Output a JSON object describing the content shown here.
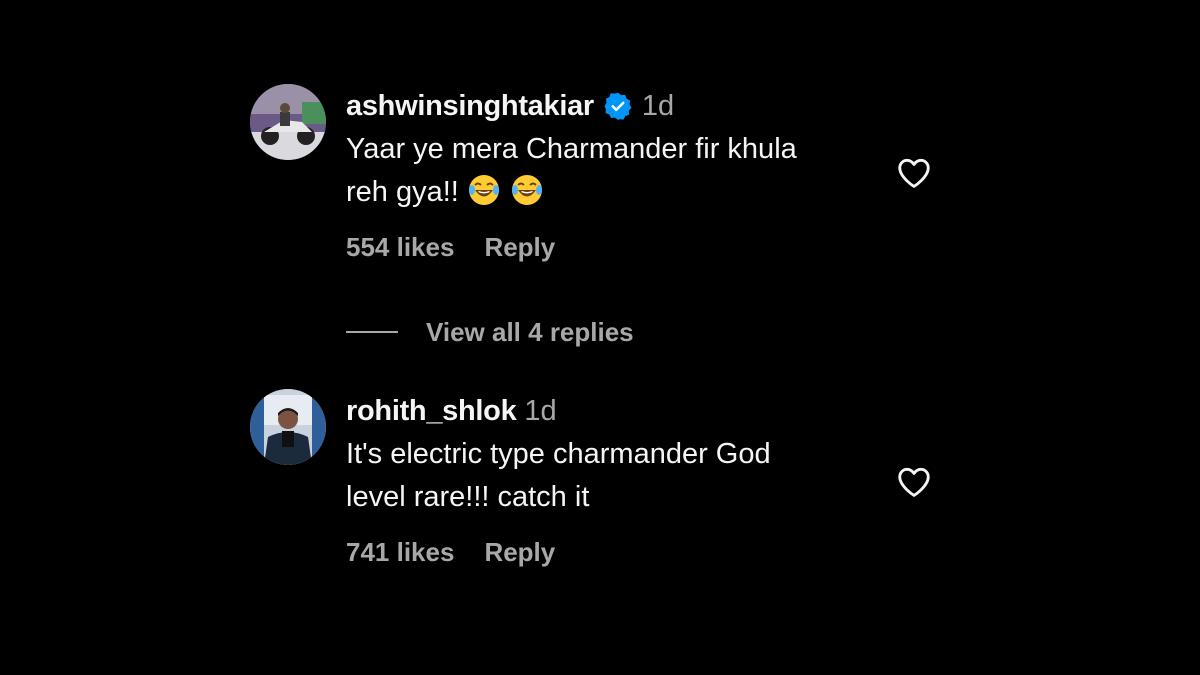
{
  "comments": [
    {
      "username": "ashwinsinghtakiar",
      "verified": true,
      "time": "1d",
      "text_line1": "Yaar ye mera Charmander fir khula",
      "text_line2": "reh gya!!",
      "emojis": [
        "face-with-tears-of-joy-icon",
        "face-with-tears-of-joy-icon"
      ],
      "likes": "554 likes",
      "reply_label": "Reply"
    },
    {
      "username": "rohith_shlok",
      "verified": false,
      "time": "1d",
      "text_line1": "It's electric type charmander God",
      "text_line2": "level rare!!! catch it",
      "likes": "741 likes",
      "reply_label": "Reply"
    }
  ],
  "view_replies_label": "View all 4 replies",
  "colors": {
    "background": "#000000",
    "primary_text": "#f5f5f5",
    "secondary_text": "#a8a8a8",
    "verified_badge": "#0095f6"
  }
}
